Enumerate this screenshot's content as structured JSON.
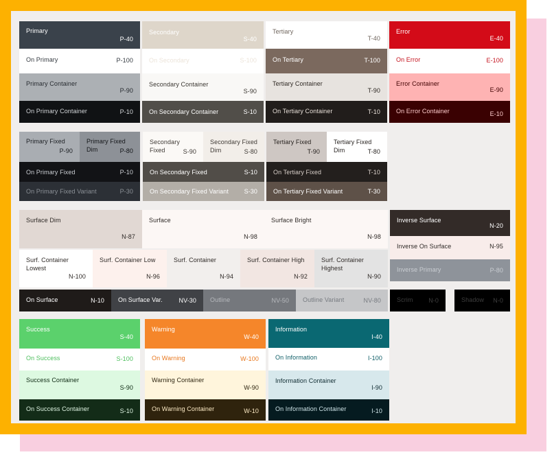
{
  "core": {
    "primary": {
      "label": "Primary",
      "code": "P-40",
      "bg": "#3a424b",
      "fg": "#ffffff"
    },
    "on_primary": {
      "label": "On Primary",
      "code": "P-100",
      "bg": "#ffffff",
      "fg": "#343a40"
    },
    "primary_container": {
      "label": "Primary Container",
      "code": "P-90",
      "bg": "#acb0b4",
      "fg": "#272b30"
    },
    "on_primary_container": {
      "label": "On Primary Container",
      "code": "P-10",
      "bg": "#101214",
      "fg": "#d2d5d8"
    },
    "secondary": {
      "label": "Secondary",
      "code": "S-40",
      "bg": "#ded6ca",
      "fg": "#ffffff"
    },
    "on_secondary": {
      "label": "On Secondary",
      "code": "S-100",
      "bg": "#ffffff",
      "fg": "#ece4da"
    },
    "secondary_container": {
      "label": "Secondary Container",
      "code": "S-90",
      "bg": "#f9f8f6",
      "fg": "#3a3631"
    },
    "on_secondary_container": {
      "label": "On Secondary Container",
      "code": "S-10",
      "bg": "#514e49",
      "fg": "#ffffff"
    },
    "tertiary": {
      "label": "Tertiary",
      "code": "T-40",
      "bg": "#ffffff",
      "fg": "#6f655d"
    },
    "on_tertiary": {
      "label": "On Tertiary",
      "code": "T-100",
      "bg": "#7b695e",
      "fg": "#ffffff"
    },
    "tertiary_container": {
      "label": "Tertiary Container",
      "code": "T-90",
      "bg": "#e7e3df",
      "fg": "#2e2823"
    },
    "on_tertiary_container": {
      "label": "On Tertiary Container",
      "code": "T-10",
      "bg": "#211d1b",
      "fg": "#e8e0d9"
    },
    "error": {
      "label": "Error",
      "code": "E-40",
      "bg": "#d30b18",
      "fg": "#ffffff"
    },
    "on_error": {
      "label": "On Error",
      "code": "E-100",
      "bg": "#ffffff",
      "fg": "#c4111c"
    },
    "error_container": {
      "label": "Error Container",
      "code": "E-90",
      "bg": "#feb3b3",
      "fg": "#3f0000"
    },
    "on_error_container": {
      "label": "On Error Container",
      "code": "E-10",
      "bg": "#3a0102",
      "fg": "#fdcccc"
    }
  },
  "fixed": {
    "primary_fixed": {
      "label": "Primary Fixed",
      "code": "P-90",
      "bg": "#a9adb2",
      "fg": "#1c1f23"
    },
    "primary_fixed_dim": {
      "label_line1": "Primary Fixed",
      "label_line2": "Dim",
      "code": "P-80",
      "bg": "#8d9197",
      "fg": "#141619"
    },
    "on_primary_fixed": {
      "label": "On Primary Fixed",
      "code": "P-10",
      "bg": "#121316",
      "fg": "#c9cdd2"
    },
    "on_primary_fixed_variant": {
      "label": "On Primary Fixed Variant",
      "code": "P-30",
      "bg": "#2c3036",
      "fg": "#8b9096"
    },
    "secondary_fixed": {
      "label_line1": "Secondary",
      "label_line2": "Fixed",
      "code": "S-90",
      "bg": "#fbf9f6",
      "fg": "#3f3a35"
    },
    "secondary_fixed_dim": {
      "label_line1": "Secondary Fixed",
      "label_line2": "Dim",
      "code": "S-80",
      "bg": "#f2eee9",
      "fg": "#3f3a35"
    },
    "on_secondary_fixed": {
      "label": "On Secondary Fixed",
      "code": "S-10",
      "bg": "#514d48",
      "fg": "#ffffff"
    },
    "on_secondary_fixed_variant": {
      "label": "On Secondary Fixed Variant",
      "code": "S-30",
      "bg": "#b3aea7",
      "fg": "#ffffff"
    },
    "tertiary_fixed": {
      "label": "Tertiary Fixed",
      "code": "T-90",
      "bg": "#cec7c3",
      "fg": "#241f1c"
    },
    "tertiary_fixed_dim": {
      "label_line1": "Tertiary Fixed",
      "label_line2": "Dim",
      "code": "T-80",
      "bg": "#ffffff",
      "fg": "#241f1c"
    },
    "on_tertiary_fixed": {
      "label": "On Tertiary Fixed",
      "code": "T-10",
      "bg": "#231f1d",
      "fg": "#d8cfc9"
    },
    "on_tertiary_fixed_variant": {
      "label": "On Tertiary Fixed Variant",
      "code": "T-30",
      "bg": "#5e5148",
      "fg": "#ffffff"
    }
  },
  "surface": {
    "surface_dim": {
      "label": "Surface Dim",
      "code": "N-87",
      "bg": "#e1d8d3",
      "fg": "#2f2a27"
    },
    "surface": {
      "label": "Surface",
      "code": "N-98",
      "bg": "#fcf7f5",
      "fg": "#2f2a27"
    },
    "surface_bright": {
      "label": "Surface Bright",
      "code": "N-98",
      "bg": "#fcf7f5",
      "fg": "#2f2a27"
    },
    "inverse_surface": {
      "label": "Inverse Surface",
      "code": "N-20",
      "bg": "#332b28",
      "fg": "#ffffff"
    },
    "inverse_on_surface": {
      "label": "Inverse On Surface",
      "code": "N-95",
      "bg": "#f8ecea",
      "fg": "#2f2a27"
    },
    "inverse_primary": {
      "label": "Inverse Primary",
      "code": "P-80",
      "bg": "#8e939a",
      "fg": "#c9cdd2"
    },
    "container_lowest": {
      "label_line1": "Surf. Container",
      "label_line2": "Lowest",
      "code": "N-100",
      "bg": "#ffffff",
      "fg": "#2f2a27"
    },
    "container_low": {
      "label": "Surf. Container Low",
      "code": "N-96",
      "bg": "#fdf1ed",
      "fg": "#2f2a27"
    },
    "container": {
      "label": "Surf. Container",
      "code": "N-94",
      "bg": "#f2efed",
      "fg": "#2f2a27"
    },
    "container_high": {
      "label": "Surf. Container High",
      "code": "N-92",
      "bg": "#f2e6e2",
      "fg": "#2f2a27"
    },
    "container_highest": {
      "label_line1": "Surf. Container",
      "label_line2": "Highest",
      "code": "N-90",
      "bg": "#e3e3e3",
      "fg": "#2f2a27"
    },
    "on_surface": {
      "label": "On Surface",
      "code": "N-10",
      "bg": "#1f1b19",
      "fg": "#ffffff"
    },
    "on_surface_var": {
      "label": "On Surface Var.",
      "code": "NV-30",
      "bg": "#404246",
      "fg": "#ffffff"
    },
    "outline": {
      "label": "Outline",
      "code": "NV-50",
      "bg": "#75787d",
      "fg": "#b6b9bd"
    },
    "outline_variant": {
      "label": "Outline Variant",
      "code": "NV-80",
      "bg": "#c5c6c8",
      "fg": "#777b80"
    },
    "scrim": {
      "label": "Scrim",
      "code": "N-0",
      "bg": "#000000",
      "fg": "#3e3e3e"
    },
    "shadow": {
      "label": "Shadow",
      "code": "N-0",
      "bg": "#000000",
      "fg": "#3e3e3e"
    }
  },
  "extended": {
    "success": {
      "label": "Success",
      "code": "S-40",
      "bg": "#5bd16c",
      "fg": "#ffffff"
    },
    "on_success": {
      "label": "On Success",
      "code": "S-100",
      "bg": "#ffffff",
      "fg": "#4ebf5e"
    },
    "success_container": {
      "label": "Success Container",
      "code": "S-90",
      "bg": "#ddf9e1",
      "fg": "#0e2a13"
    },
    "on_success_container": {
      "label": "On Success Container",
      "code": "S-10",
      "bg": "#132c18",
      "fg": "#dff5e3"
    },
    "warning": {
      "label": "Warning",
      "code": "W-40",
      "bg": "#f5862a",
      "fg": "#ffffff"
    },
    "on_warning": {
      "label": "On Warning",
      "code": "W-100",
      "bg": "#ffffff",
      "fg": "#e8771d"
    },
    "warning_container": {
      "label": "Warning Container",
      "code": "W-90",
      "bg": "#fff5dc",
      "fg": "#2f2611"
    },
    "on_warning_container": {
      "label": "On Warning Container",
      "code": "W-10",
      "bg": "#2f230d",
      "fg": "#fbe9c4"
    },
    "information": {
      "label": "Information",
      "code": "I-40",
      "bg": "#0a6872",
      "fg": "#ffffff"
    },
    "on_information": {
      "label": "On Information",
      "code": "I-100",
      "bg": "#ffffff",
      "fg": "#0d5d66"
    },
    "information_container": {
      "label": "Information Container",
      "code": "I-90",
      "bg": "#d7e8ec",
      "fg": "#0e2a30"
    },
    "on_information_container": {
      "label": "On Information Container",
      "code": "I-10",
      "bg": "#051b20",
      "fg": "#cfe4e8"
    }
  }
}
